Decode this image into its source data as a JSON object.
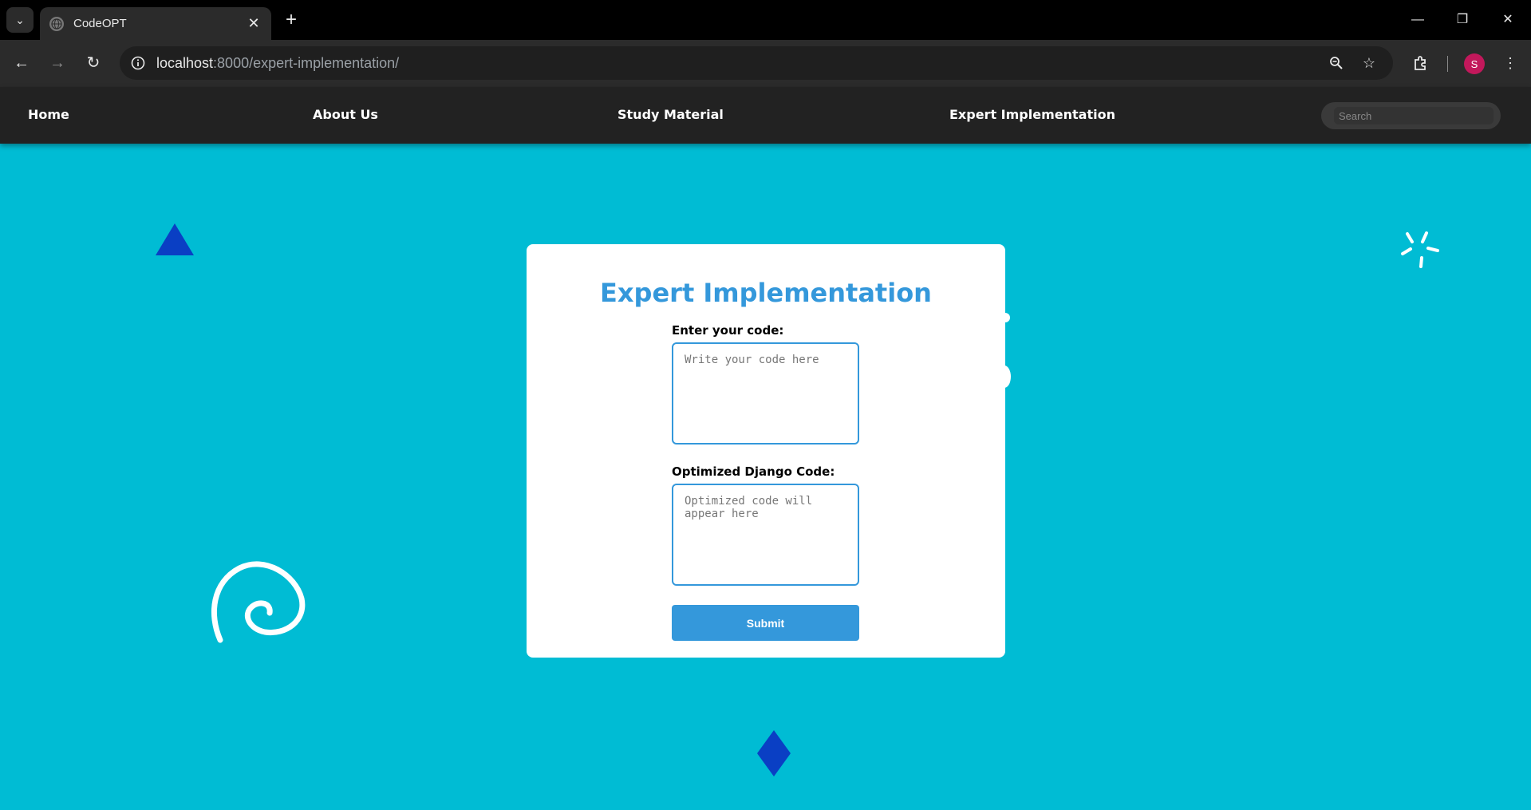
{
  "browser": {
    "tab_title": "CodeOPT",
    "url_host": "localhost",
    "url_rest": ":8000/expert-implementation/",
    "profile_initial": "S"
  },
  "nav": {
    "items": [
      "Home",
      "About Us",
      "Study Material",
      "Expert Implementation"
    ],
    "search_placeholder": "Search"
  },
  "form": {
    "title": "Expert Implementation",
    "code_label": "Enter your code:",
    "code_placeholder": "Write your code here",
    "output_label": "Optimized Django Code:",
    "output_placeholder": "Optimized code will appear here",
    "submit_label": "Submit"
  },
  "colors": {
    "page_bg": "#00bcd4",
    "accent": "#3498db",
    "nav_bg": "#222222",
    "deco_blue": "#0a3fc4"
  }
}
